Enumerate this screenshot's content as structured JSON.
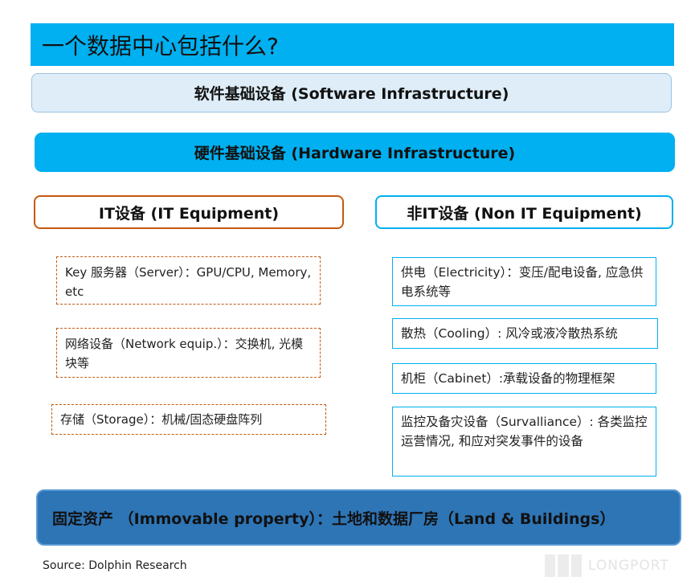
{
  "title": "一个数据中心包括什么?",
  "software": "软件基础设备 (Software Infrastructure)",
  "hardware": "硬件基础设备 (Hardware Infrastructure)",
  "it": {
    "heading": "IT设备 (IT Equipment)",
    "items": [
      "Key 服务器（Server）：GPU/CPU, Memory, etc",
      "网络设备（Network equip.）：交换机, 光模块等",
      "存储（Storage）：机械/固态硬盘阵列"
    ]
  },
  "non_it": {
    "heading": "非IT设备 (Non IT Equipment)",
    "items": [
      "供电（Electricity）：变压/配电设备, 应急供电系统等",
      "散热（Cooling）: 风冷或液冷散热系统",
      "机柜（Cabinet）:承载设备的物理框架",
      "监控及备灾设备（Survalliance）: 各类监控运营情况, 和应对突发事件的设备"
    ]
  },
  "immovable": "固定资产 （Immovable property）：土地和数据厂房（Land & Buildings）",
  "source": "Source: Dolphin Research",
  "watermark": "LONGPORT",
  "colors": {
    "accent": "#00b0f0",
    "it_border": "#c55a11",
    "bottom": "#2e75b6"
  }
}
